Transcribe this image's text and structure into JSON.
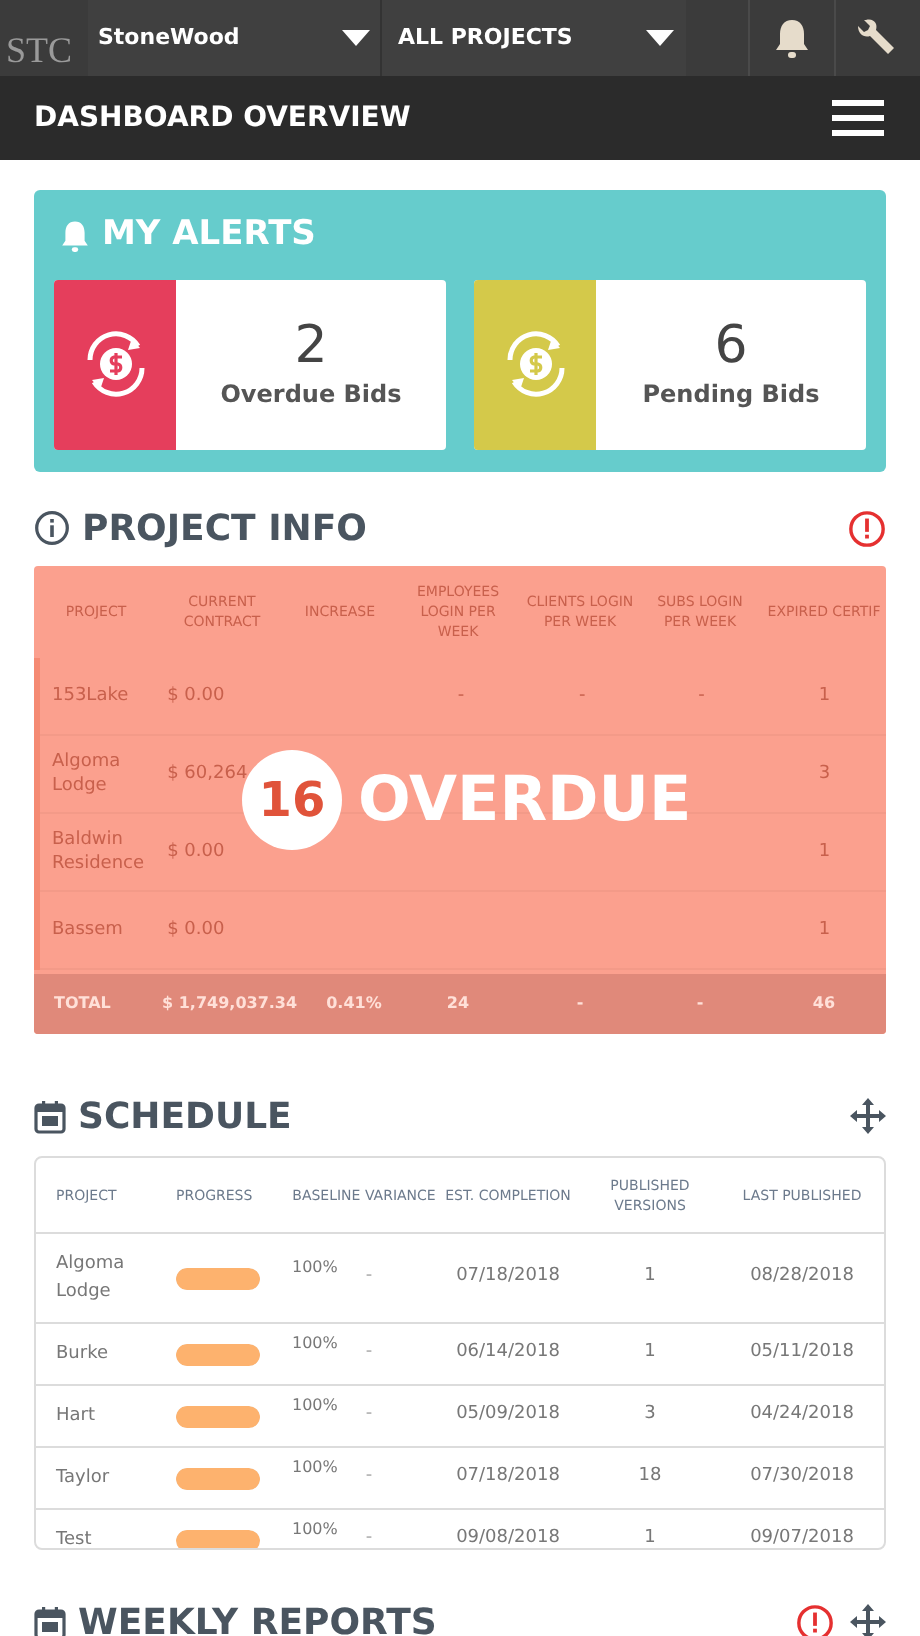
{
  "topbar": {
    "logo": "STC",
    "company": "StoneWood",
    "project_filter": "ALL PROJECTS"
  },
  "header": {
    "title": "DASHBOARD OVERVIEW"
  },
  "alerts": {
    "title": "MY ALERTS",
    "items": [
      {
        "count": "2",
        "label": "Overdue Bids",
        "color": "#e53e5c"
      },
      {
        "count": "6",
        "label": "Pending Bids",
        "color": "#d4c94a"
      }
    ]
  },
  "project_info": {
    "title": "PROJECT INFO",
    "warning": true,
    "columns": [
      "PROJECT",
      "CURRENT CONTRACT",
      "INCREASE",
      "EMPLOYEES LOGIN PER WEEK",
      "CLIENTS LOGIN PER WEEK",
      "SUBS LOGIN PER WEEK",
      "EXPIRED CERTIF"
    ],
    "rows": [
      [
        "153Lake",
        "$ 0.00",
        "",
        "-",
        "-",
        "-",
        "1"
      ],
      [
        "Algoma Lodge",
        "$ 60,264",
        "",
        "",
        "",
        "",
        "3"
      ],
      [
        "Baldwin Residence",
        "$ 0.00",
        "",
        "",
        "",
        "",
        "1"
      ],
      [
        "Bassem",
        "$ 0.00",
        "",
        "",
        "",
        "",
        "1"
      ]
    ],
    "total": [
      "TOTAL",
      "$ 1,749,037.34",
      "0.41%",
      "24",
      "-",
      "-",
      "46"
    ],
    "overlay": {
      "count": "16",
      "label": "OVERDUE"
    }
  },
  "schedule": {
    "title": "SCHEDULE",
    "columns": [
      "PROJECT",
      "PROGRESS",
      "BASELINE VARIANCE",
      "EST. COMPLETION",
      "PUBLISHED VERSIONS",
      "LAST PUBLISHED"
    ],
    "rows": [
      {
        "project": "Algoma Lodge",
        "level": 1,
        "percent": "100%",
        "variance": "-",
        "completion": "07/18/2018",
        "versions": "1",
        "last": "08/28/2018"
      },
      {
        "project": "Burke",
        "level": 1,
        "percent": "100%",
        "variance": "-",
        "completion": "06/14/2018",
        "versions": "1",
        "last": "05/11/2018"
      },
      {
        "project": "Hart",
        "level": 1,
        "percent": "100%",
        "variance": "-",
        "completion": "05/09/2018",
        "versions": "3",
        "last": "04/24/2018"
      },
      {
        "project": "Taylor",
        "level": 1,
        "percent": "100%",
        "variance": "-",
        "completion": "07/18/2018",
        "versions": "18",
        "last": "07/30/2018"
      },
      {
        "project": "Test",
        "level": 1,
        "percent": "100%",
        "variance": "-",
        "completion": "09/08/2018",
        "versions": "1",
        "last": "09/07/2018"
      }
    ]
  },
  "weekly_reports": {
    "title": "WEEKLY REPORTS",
    "warning": true
  }
}
